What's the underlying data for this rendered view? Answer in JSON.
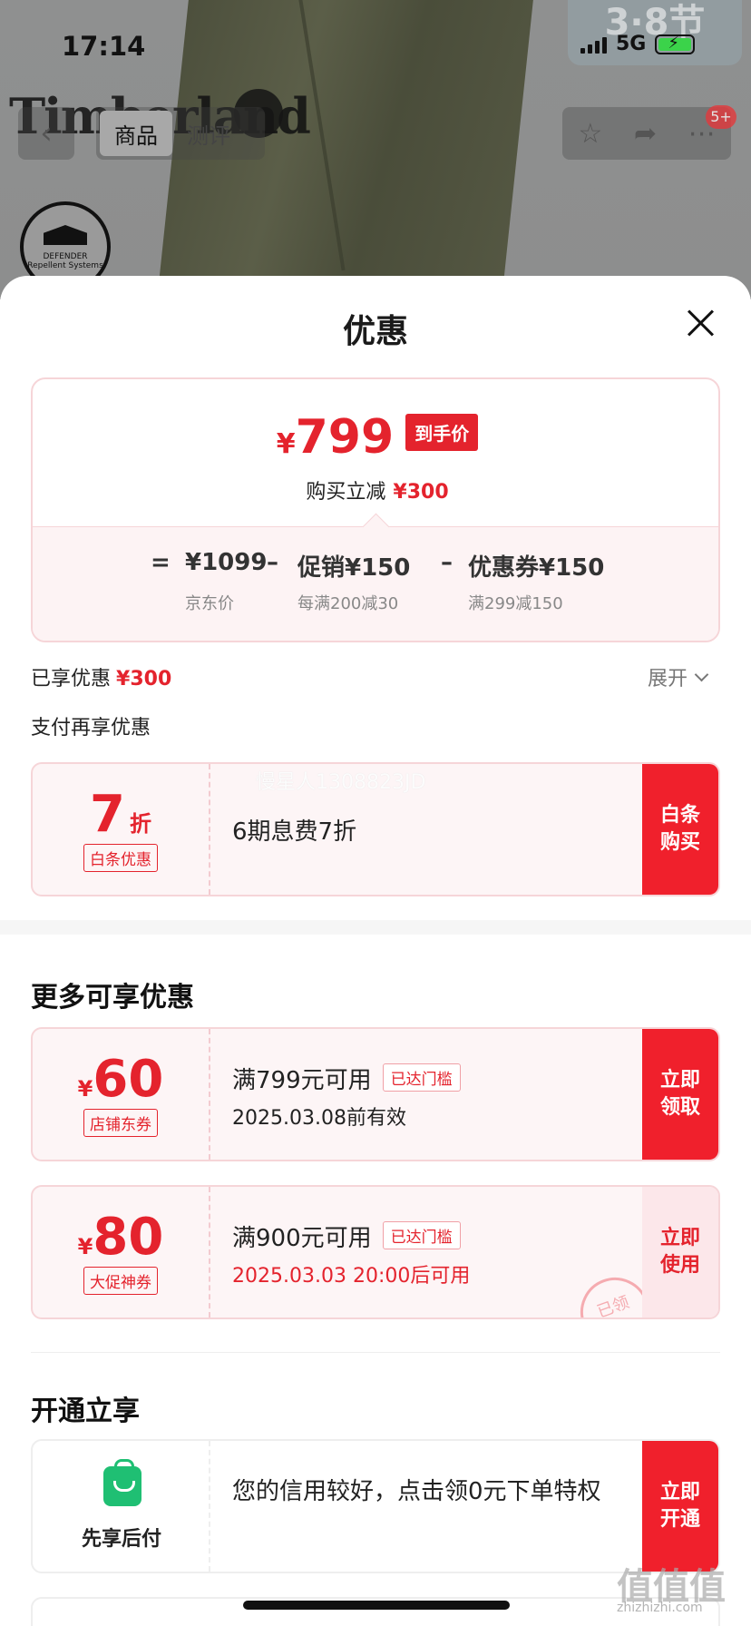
{
  "status_bar": {
    "time": "17:14",
    "network": "5G",
    "top_badge": "3·8节"
  },
  "header": {
    "brand_logo": "Timberland",
    "defender_text": "DEFENDER Repellent Systems",
    "tabs": [
      {
        "label": "商品",
        "active": true
      },
      {
        "label": "测评",
        "active": false
      }
    ],
    "message_badge": "5+"
  },
  "sheet": {
    "title": "优惠",
    "price": {
      "currency": "¥",
      "final": "799",
      "final_tag": "到手价",
      "saving_label": "购买立减",
      "saving_value": "¥300",
      "equals": "=",
      "base": "¥1099",
      "base_note": "京东价",
      "minus1": "–",
      "promo": "促销¥150",
      "promo_note": "每满200减30",
      "minus2": "–",
      "coupon": "优惠券¥150",
      "coupon_note": "满299减150"
    },
    "enjoyed_label": "已享优惠",
    "enjoyed_value": "¥300",
    "expand_label": "展开",
    "pay_more_label": "支付再享优惠",
    "baitiao": {
      "discount": "7",
      "discount_unit": "折",
      "tag": "白条优惠",
      "desc": "6期息费7折",
      "button": "白条购买",
      "watermark": "慢星人1308823JD"
    },
    "more_title": "更多可享优惠",
    "coupons": [
      {
        "currency": "¥",
        "amount": "60",
        "tag": "店铺东券",
        "condition": "满799元可用",
        "reach_tag": "已达门槛",
        "validity": "2025.03.08前有效",
        "validity_red": false,
        "button": "立即领取",
        "button_style": "solid"
      },
      {
        "currency": "¥",
        "amount": "80",
        "tag": "大促神券",
        "condition": "满900元可用",
        "reach_tag": "已达门槛",
        "validity": "2025.03.03 20:00后可用",
        "validity_red": true,
        "button": "立即使用",
        "button_style": "light",
        "stamp": "已领"
      }
    ],
    "open_title": "开通立享",
    "paylater": {
      "label": "先享后付",
      "desc": "您的信用较好，点击领0元下单特权",
      "button": "立即开通"
    }
  },
  "footer": {
    "site_mark": "值值值",
    "site_url": "zhizhizhi.com"
  },
  "colors": {
    "accent": "#e4232d",
    "card_border": "#f6d5d8",
    "card_bg": "#fdf5f6",
    "green": "#1fbf73"
  }
}
